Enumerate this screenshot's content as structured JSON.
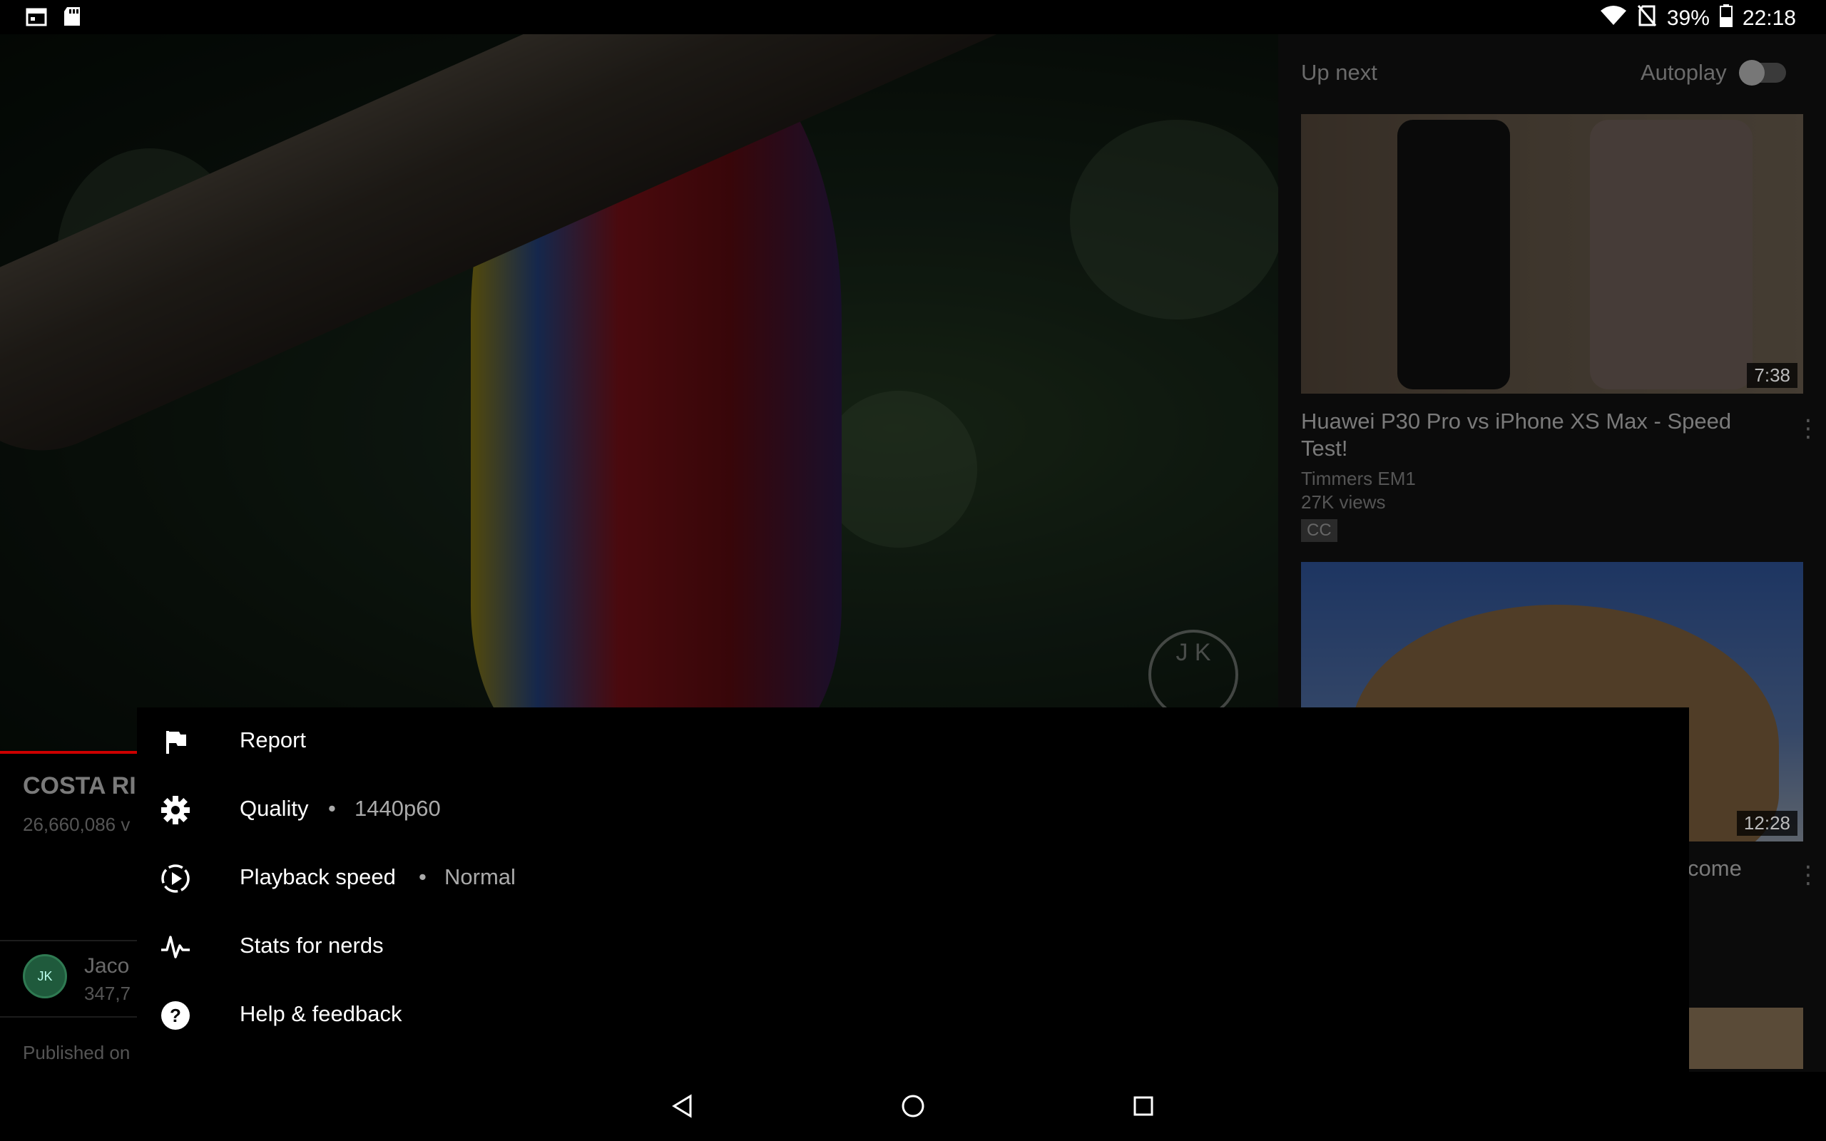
{
  "status_bar": {
    "battery_percent": "39%",
    "time": "22:18",
    "left_icons": [
      "calendar-icon",
      "sd-card-icon"
    ],
    "right_icons": [
      "wifi-icon",
      "no-sim-icon",
      "battery-icon"
    ]
  },
  "video": {
    "title": "COSTA RI",
    "views": "26,660,086 v",
    "channel_name": "Jaco",
    "channel_subs": "347,7",
    "published": "Published on",
    "watermark_letters": "J K"
  },
  "up_next": {
    "header": "Up next",
    "autoplay_label": "Autoplay",
    "autoplay_on": false,
    "items": [
      {
        "title": "Huawei P30 Pro vs iPhone XS Max - Speed Test!",
        "channel": "Timmers EM1",
        "views": "27K views",
        "badge": "CC",
        "duration": "7:38"
      },
      {
        "title": "come",
        "duration": "12:28"
      }
    ]
  },
  "menu": {
    "items": [
      {
        "icon": "flag-icon",
        "label": "Report"
      },
      {
        "icon": "gear-icon",
        "label": "Quality",
        "separator": "•",
        "value": "1440p60"
      },
      {
        "icon": "playback-speed-icon",
        "label": "Playback speed",
        "separator": "•",
        "value": "Normal"
      },
      {
        "icon": "pulse-icon",
        "label": "Stats for nerds"
      },
      {
        "icon": "help-icon",
        "label": "Help & feedback"
      }
    ]
  },
  "nav_bar": {
    "buttons": [
      "back-icon",
      "home-icon",
      "recents-icon"
    ]
  },
  "colors": {
    "accent_red": "#cc0000",
    "sheet_bg": "#000000",
    "menu_text": "#ffffff",
    "menu_value_text": "#aaaaaa"
  }
}
